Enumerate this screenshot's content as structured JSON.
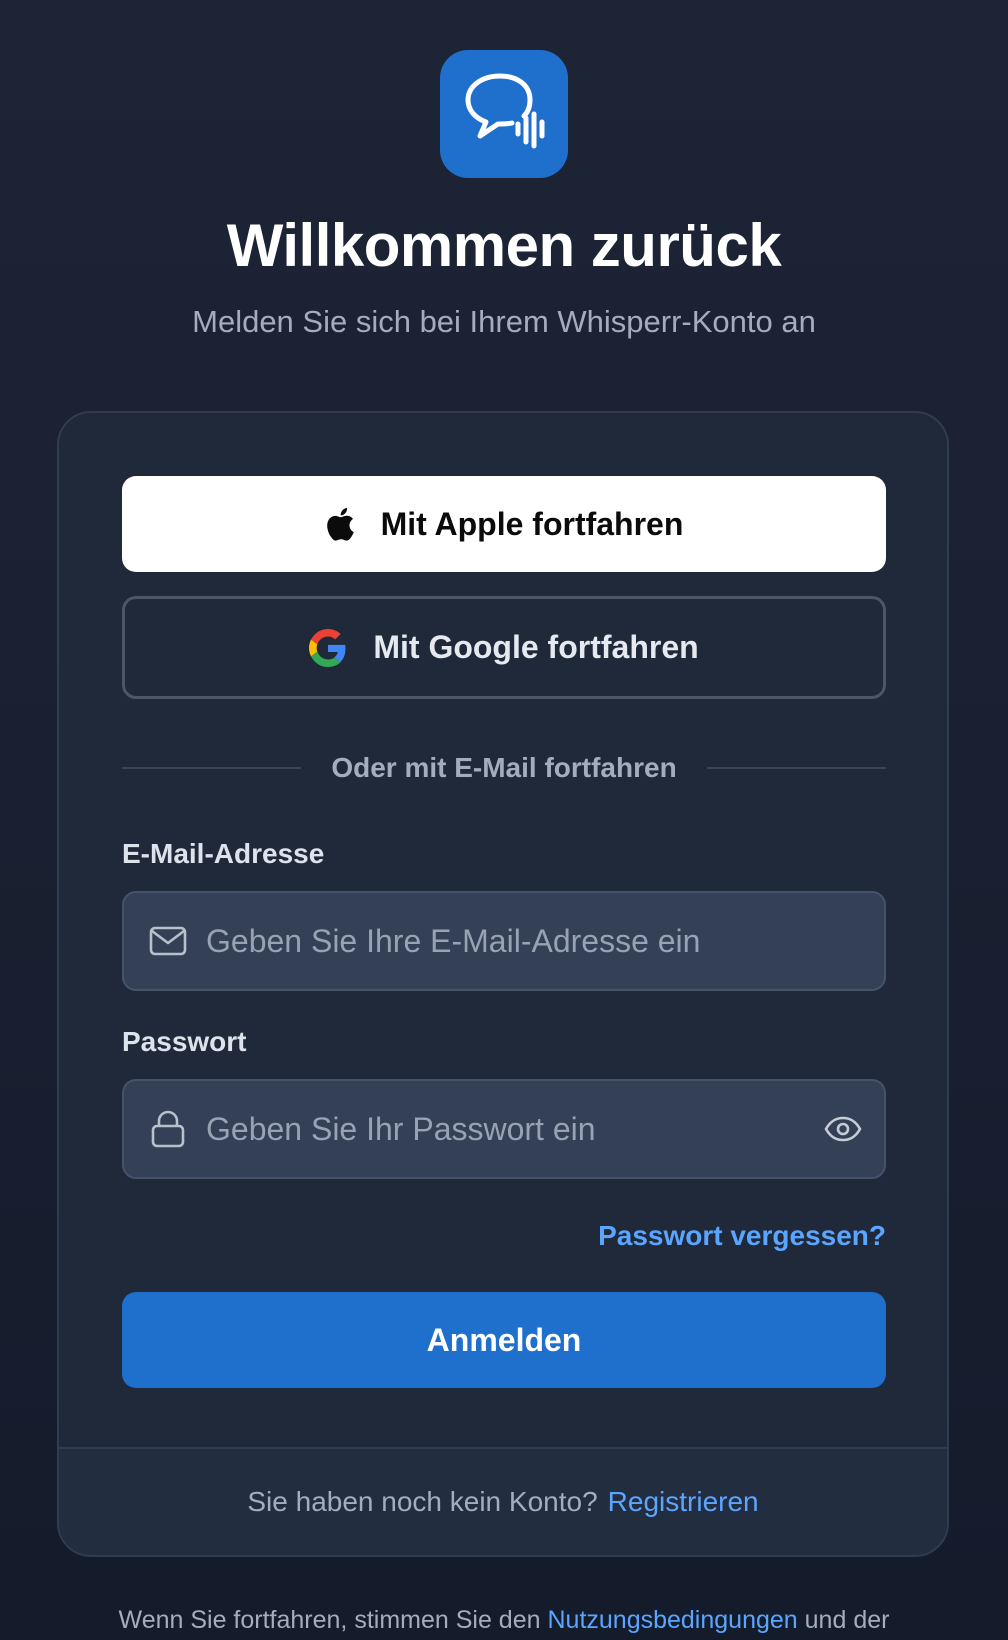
{
  "header": {
    "logo_icon": "chat-bubble-soundwave-icon",
    "title": "Willkommen zurück",
    "subtitle": "Melden Sie sich bei Ihrem Whisperr-Konto an"
  },
  "social": {
    "apple_label": "Mit Apple fortfahren",
    "apple_icon": "apple-icon",
    "google_label": "Mit Google fortfahren",
    "google_icon": "google-icon"
  },
  "divider_text": "Oder mit E-Mail fortfahren",
  "form": {
    "email_label": "E-Mail-Adresse",
    "email_placeholder": "Geben Sie Ihre E-Mail-Adresse ein",
    "email_value": "",
    "password_label": "Passwort",
    "password_placeholder": "Geben Sie Ihr Passwort ein",
    "password_value": "",
    "forgot_label": "Passwort vergessen?",
    "submit_label": "Anmelden"
  },
  "footer": {
    "prompt": "Sie haben noch kein Konto?",
    "register_label": "Registrieren"
  },
  "legal": {
    "prefix": "Wenn Sie fortfahren, stimmen Sie den",
    "terms_label": "Nutzungsbedingungen",
    "suffix": "und der"
  },
  "colors": {
    "accent": "#1f6fcc",
    "link": "#5ba5ff",
    "background": "#1a2233",
    "card": "#1f293a"
  }
}
